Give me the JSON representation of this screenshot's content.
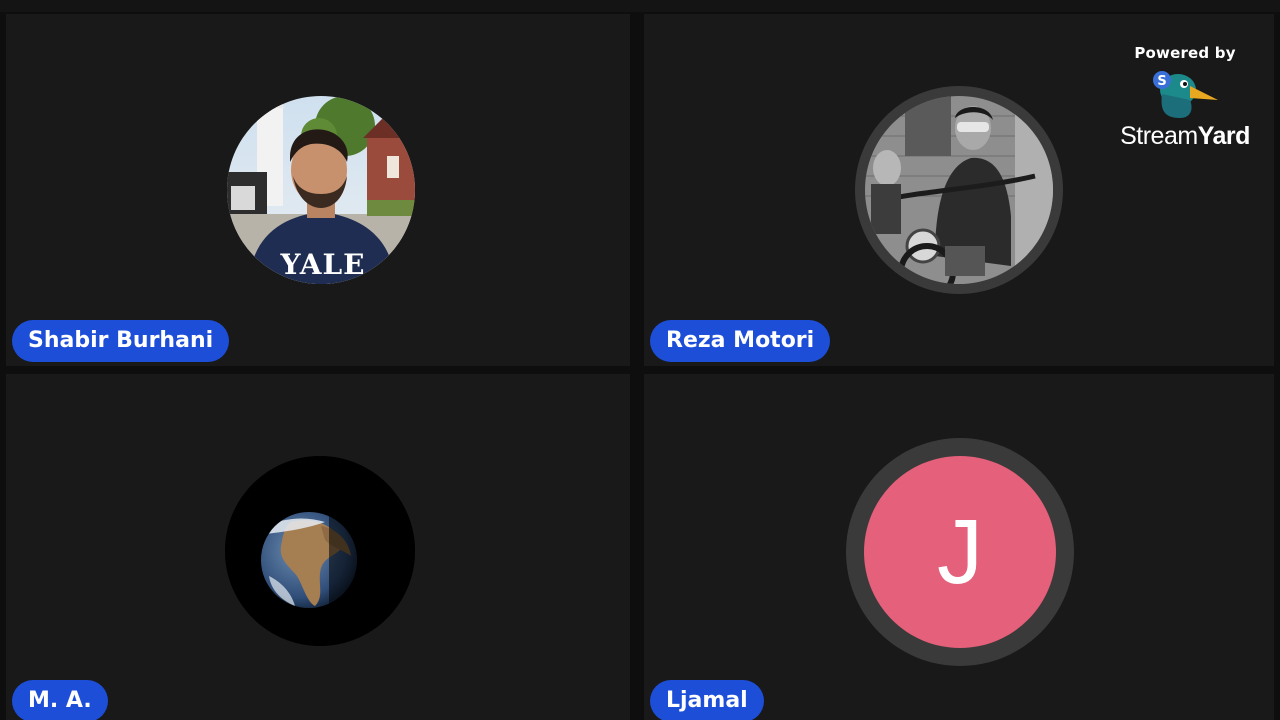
{
  "branding": {
    "powered_by": "Powered by",
    "brand_light": "Stream",
    "brand_bold": "Yard",
    "logo_icon": "streamyard-duck-icon"
  },
  "participants": [
    {
      "name": "Shabir Burhani",
      "avatar": "photo",
      "avatar_icon": "man-yale-shirt-photo"
    },
    {
      "name": "Reza Motori",
      "avatar": "photo",
      "avatar_icon": "motorcycle-rider-photo"
    },
    {
      "name": "M. A.",
      "avatar": "photo",
      "avatar_icon": "earth-globe-photo"
    },
    {
      "name": "Ljamal",
      "avatar": "initial",
      "initial": "J",
      "avatar_color": "#e5607a"
    }
  ],
  "colors": {
    "name_badge": "#1d4ed8",
    "tile_background": "#191919",
    "avatar_ring": "#3a3a3a"
  }
}
